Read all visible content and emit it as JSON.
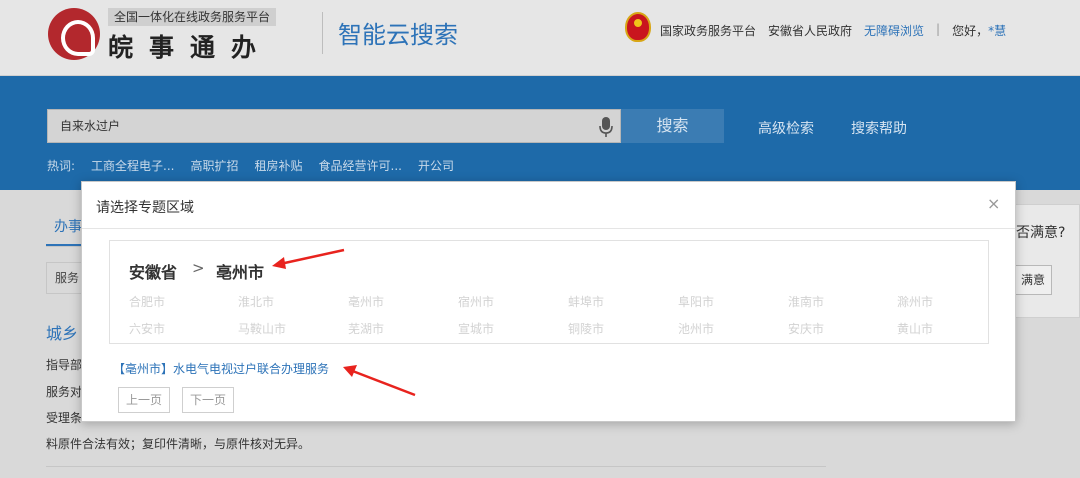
{
  "header": {
    "logo_subtitle": "全国一体化在线政务服务平台",
    "logo_name": "皖事通办",
    "site_title": "智能云搜索",
    "links": [
      "国家政务服务平台",
      "安徽省人民政府"
    ],
    "accessibility_link": "无障碍浏览",
    "separator": "|",
    "greeting": "您好，",
    "user_name": "*慧"
  },
  "search": {
    "query": "自来水过户",
    "button_label": "搜索",
    "advanced_label": "高级检索",
    "help_label": "搜索帮助",
    "hot_label": "热词:",
    "hot_words": [
      "工商全程电子...",
      "高职扩招",
      "租房补贴",
      "食品经营许可...",
      "开公司"
    ]
  },
  "background": {
    "tab_label": "办事",
    "box_label": "服务",
    "section_heading": "城乡",
    "lines": [
      "指导部",
      "服务对",
      "受理条",
      "料原件合法有效；复印件清晰，与原件核对无异。"
    ],
    "side_question": "否满意?",
    "side_button": "满意"
  },
  "modal": {
    "title": "请选择专题区域",
    "close_glyph": "×",
    "province": "安徽省",
    "crumb_separator": ">",
    "selected_city": "亳州市",
    "cities": [
      "合肥市",
      "淮北市",
      "亳州市",
      "宿州市",
      "蚌埠市",
      "阜阳市",
      "淮南市",
      "滁州市",
      "六安市",
      "马鞍山市",
      "芜湖市",
      "宣城市",
      "铜陵市",
      "池州市",
      "安庆市",
      "黄山市"
    ],
    "result_link": "【亳州市】水电气电视过户联合办理服务",
    "prev_page": "上一页",
    "next_page": "下一页"
  },
  "colors": {
    "brand_blue": "#1e6aa9",
    "link_blue": "#2d73b8",
    "logo_red": "#b3282d",
    "annotation_red": "#e8231e"
  }
}
